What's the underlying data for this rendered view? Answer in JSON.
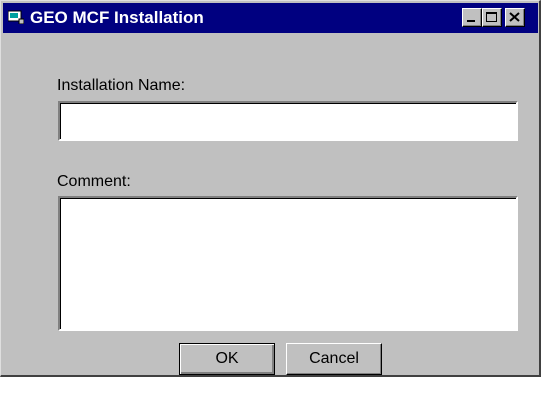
{
  "window": {
    "title": "GEO MCF Installation",
    "controls": [
      "minimize-icon",
      "maximize-icon",
      "close-icon"
    ]
  },
  "form": {
    "installation_name_label": "Installation Name:",
    "installation_name_value": "",
    "comment_label": "Comment:",
    "comment_value": ""
  },
  "buttons": {
    "ok_label": "OK",
    "cancel_label": "Cancel"
  },
  "colors": {
    "titlebar": "#000080",
    "face": "#c0c0c0"
  }
}
